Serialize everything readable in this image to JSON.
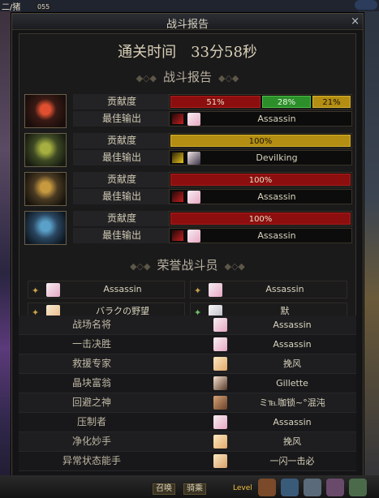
{
  "topbar": {
    "left_text": "二/猪",
    "badge": "055"
  },
  "window": {
    "title": "战斗报告",
    "close_icon": "×",
    "clear_time": "通关时间　33分58秒",
    "section_report": "战斗报告",
    "section_honor": "荣誉战斗员",
    "deco": "◆◇◆"
  },
  "labels": {
    "contribution": "贡献度",
    "best_output": "最佳输出"
  },
  "players": [
    {
      "avatar": "fire-class-avatar",
      "segments": [
        {
          "text": "51%",
          "percent": 51,
          "color": "red"
        },
        {
          "text": "28%",
          "percent": 28,
          "color": "green"
        },
        {
          "text": "21%",
          "percent": 21,
          "color": "yellow"
        }
      ],
      "best_weapon": "red-weapon-icon",
      "best_char": "pink-haired-char-icon",
      "best_name": "Assassin"
    },
    {
      "avatar": "green-class-avatar",
      "segments": [
        {
          "text": "100%",
          "percent": 100,
          "color": "yellow"
        }
      ],
      "best_weapon": "yellow-weapon-icon",
      "best_char": "dark-haired-char-icon",
      "best_name": "Devilking"
    },
    {
      "avatar": "gold-class-avatar",
      "segments": [
        {
          "text": "100%",
          "percent": 100,
          "color": "red"
        }
      ],
      "best_weapon": "red-weapon-icon",
      "best_char": "pink-haired-char-icon",
      "best_name": "Assassin"
    },
    {
      "avatar": "blue-class-avatar",
      "segments": [
        {
          "text": "100%",
          "percent": 100,
          "color": "red"
        }
      ],
      "best_weapon": "red-weapon-icon",
      "best_char": "pink-haired-char-icon",
      "best_name": "Assassin"
    }
  ],
  "honor": [
    {
      "name": "Assassin",
      "medal": "✦"
    },
    {
      "name": "Assassin",
      "medal": "✦"
    },
    {
      "name": "バラクの野望",
      "medal": "✦"
    },
    {
      "name": "默",
      "medal": "✦"
    }
  ],
  "awards": [
    {
      "title": "战场名将",
      "name": "Assassin",
      "icon": "pink"
    },
    {
      "title": "一击决胜",
      "name": "Assassin",
      "icon": "pink"
    },
    {
      "title": "救援专家",
      "name": "挽风",
      "icon": "blonde"
    },
    {
      "title": "晶块富翁",
      "name": "Gillette",
      "icon": "dark"
    },
    {
      "title": "回避之神",
      "name": "ミ℡咖锁~°混沌",
      "icon": "brown"
    },
    {
      "title": "压制者",
      "name": "Assassin",
      "icon": "pink"
    },
    {
      "title": "净化妙手",
      "name": "挽风",
      "icon": "blonde"
    },
    {
      "title": "异常状态能手",
      "name": "一闪一击必",
      "icon": "blonde"
    }
  ],
  "bottom": {
    "btn1": "召唤",
    "btn2": "骑乘",
    "level": "Level"
  }
}
